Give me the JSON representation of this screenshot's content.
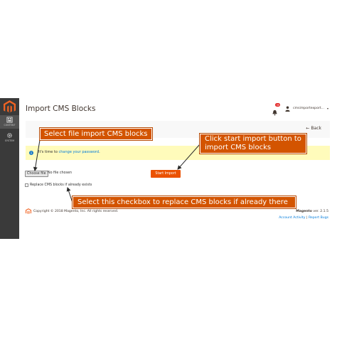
{
  "sidebar": {
    "items": [
      {
        "label": "CONTENT",
        "icon": "content-icon"
      },
      {
        "label": "SYSTEM",
        "icon": "gear-icon"
      }
    ]
  },
  "header": {
    "title": "Import CMS Blocks",
    "notification_count": "39",
    "username": "cmsimportexport..."
  },
  "actions": {
    "back_label": "Back"
  },
  "notice": {
    "text_before": "It's time to ",
    "link_text": "change your password",
    "text_after": "."
  },
  "form": {
    "choose_file_label": "Choose file",
    "file_status": "No file chosen",
    "start_import_label": "Start Import",
    "replace_label": "Replace CMS blocks if already exists",
    "replace_checked": false
  },
  "footer": {
    "copyright": "Copyright © 2018 Magento, Inc. All rights reserved.",
    "version_brand": "Magento",
    "version_text": " ver. 2.1.5",
    "link_activity": "Account Activity",
    "link_separator": "|",
    "link_report": "Report Bugs"
  },
  "annotations": {
    "file_callout": "Select file import CMS blocks",
    "start_callout": "Click start import button to import CMS blocks",
    "checkbox_callout": "Select this checkbox to replace CMS blocks if already there"
  },
  "colors": {
    "brand_orange": "#eb5202",
    "callout_orange": "#d35400",
    "sidebar": "#3a3a3a",
    "notice_bg": "#fffbbb",
    "link_blue": "#007bdb"
  }
}
